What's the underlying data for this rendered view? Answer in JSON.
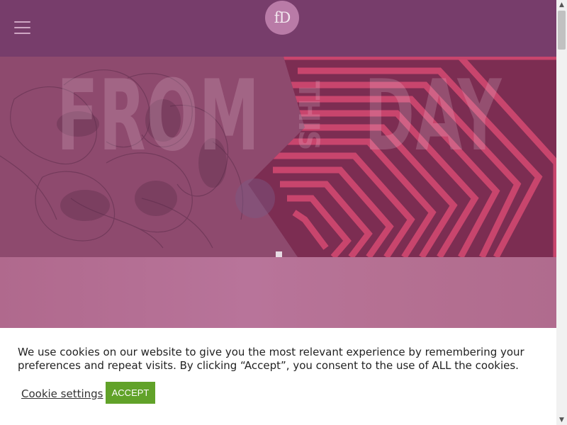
{
  "header": {
    "logo_text": "fD",
    "menu_icon": "hamburger-menu-icon",
    "background_color": "#773d6b"
  },
  "hero": {
    "title_left": "FROM",
    "title_vertical": "THIS",
    "title_right": "DAY",
    "loader_icon": "loading-bars-icon"
  },
  "cookie_notice": {
    "text": "We use cookies on our website to give you the most relevant experience by remembering your preferences and repeat visits. By clicking “Accept”, you consent to the use of ALL the cookies.",
    "settings_label": "Cookie settings",
    "accept_label": "ACCEPT",
    "accept_color": "#61a229"
  },
  "scrollbar": {
    "up_icon": "▲",
    "down_icon": "▼"
  }
}
